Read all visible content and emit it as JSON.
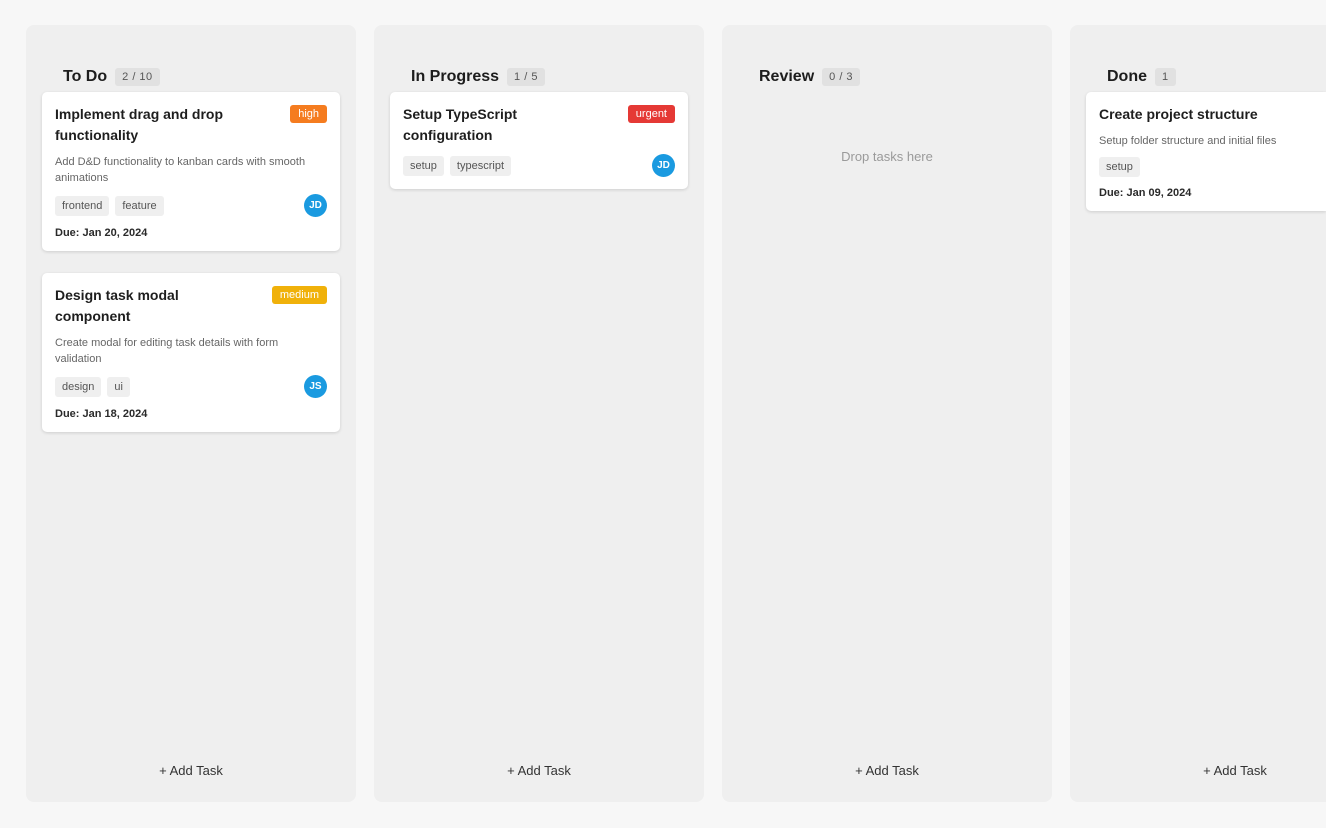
{
  "colors": {
    "background": "#f7f7f7",
    "column": "#efefef",
    "high": "#f57c1f",
    "urgent": "#e53935",
    "medium": "#f0b10a",
    "avatar": "#1a9ae0"
  },
  "columns": [
    {
      "title": "To Do",
      "count": "2 / 10",
      "add_label": "+ Add Task",
      "cards": [
        {
          "title": "Implement drag and drop functionality",
          "priority": "high",
          "description": "Add D&D functionality to kanban cards with smooth animations",
          "tags": [
            "frontend",
            "feature"
          ],
          "assignee": "JD",
          "due": "Due: Jan 20, 2024"
        },
        {
          "title": "Design task modal component",
          "priority": "medium",
          "description": "Create modal for editing task details with form validation",
          "tags": [
            "design",
            "ui"
          ],
          "assignee": "JS",
          "due": "Due: Jan 18, 2024"
        }
      ]
    },
    {
      "title": "In Progress",
      "count": "1 / 5",
      "add_label": "+ Add Task",
      "cards": [
        {
          "title": "Setup TypeScript configuration",
          "priority": "urgent",
          "tags": [
            "setup",
            "typescript"
          ],
          "assignee": "JD"
        }
      ]
    },
    {
      "title": "Review",
      "count": "0 / 3",
      "add_label": "+ Add Task",
      "empty_hint": "Drop tasks here",
      "cards": []
    },
    {
      "title": "Done",
      "count": "1",
      "add_label": "+ Add Task",
      "cards": [
        {
          "title": "Create project structure",
          "description": "Setup folder structure and initial files",
          "tags": [
            "setup"
          ],
          "due": "Due: Jan 09, 2024"
        }
      ]
    }
  ]
}
